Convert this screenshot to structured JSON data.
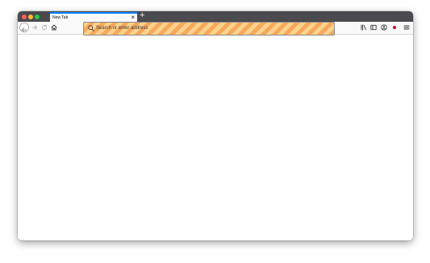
{
  "window": {
    "traffic_lights": {
      "close_color": "#fe5f57",
      "minimize_color": "#febc2e",
      "zoom_color": "#28c840"
    }
  },
  "tabs": [
    {
      "title": "New Tab",
      "active": true
    }
  ],
  "new_tab_label": "+",
  "close_tab_label": "×",
  "navigation": {
    "back_icon": "back-arrow-icon",
    "forward_icon": "forward-arrow-icon",
    "reload_icon": "reload-icon",
    "home_icon": "home-icon"
  },
  "urlbar": {
    "placeholder": "Search or enter address",
    "value": "",
    "search_icon": "search-icon",
    "background_pattern": "diagonal orange stripes",
    "stripe_colors": [
      "#f7a85b",
      "#fbd38d"
    ]
  },
  "toolbar_right": [
    {
      "name": "library-icon"
    },
    {
      "name": "sidebar-icon"
    },
    {
      "name": "account-icon"
    },
    {
      "name": "extension-icon",
      "color": "#d70022"
    },
    {
      "name": "menu-icon"
    }
  ],
  "colors": {
    "titlebar": "#4a4a4f",
    "toolbar": "#f9f9fa",
    "tab_accent": "#0a84ff"
  }
}
